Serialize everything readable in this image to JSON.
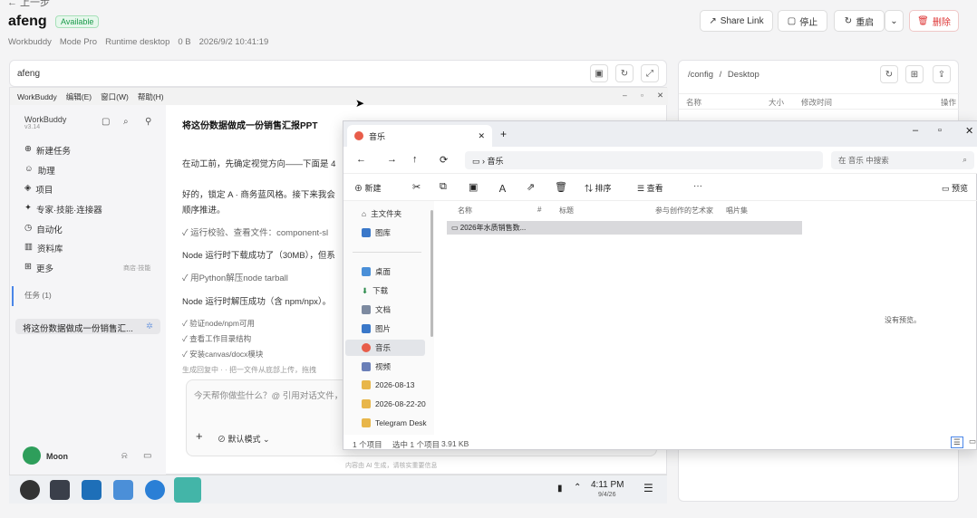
{
  "header": {
    "back": "← 上一步",
    "name": "afeng",
    "status": "Available",
    "meta": [
      "Workbuddy",
      "Mode Pro",
      "Runtime desktop",
      "0 B",
      "2026/9/2 10:41:19"
    ],
    "buttons": {
      "share": "Share Link",
      "stop": "停止",
      "restart": "重启",
      "delete": "删除"
    }
  },
  "remote": {
    "tab": "afeng"
  },
  "files": {
    "path_root": "/config",
    "path_sep": "/",
    "path_leaf": "Desktop",
    "cols": [
      "名称",
      "大小",
      "修改时间",
      "操作"
    ]
  },
  "workbuddy": {
    "menu": [
      "WorkBuddy",
      "编辑(E)",
      "窗口(W)",
      "帮助(H)"
    ],
    "app": "WorkBuddy",
    "version": "v3.14",
    "nav": [
      "新建任务",
      "助理",
      "项目",
      "专家·技能·连接器",
      "自动化",
      "资料库",
      "更多"
    ],
    "more_hint": "商店·技能",
    "tasks_label": "任务 (1)",
    "task_item": "将这份数据做成一份销售汇...",
    "user": "Moon",
    "chat_title": "将这份数据做成一份销售汇报PPT",
    "lines": [
      "在动工前，先确定视觉方向——下面是 4",
      "好的，锁定 A · 商务蓝风格。接下来我会",
      "顺序推进。",
      "运行校验、查看文件：component-sl",
      "Node 运行时下载成功了（30MB），但系",
      "用Python解压node tarball",
      "Node 运行时解压成功（含 npm/npx）。",
      "验证node/npm可用",
      "查看工作目录结构",
      "安装canvas/docx模块",
      "生成回复中 · · 把一文件从底部上传，拖拽"
    ],
    "input_placeholder": "今天帮你做些什么？@ 引用对话文件，",
    "mode": "默认模式",
    "footer": "内容由 AI 生成，请核实重要信息"
  },
  "taskbar": {
    "time": "4:11 PM",
    "date": "9/4/26"
  },
  "explorer": {
    "tab": "音乐",
    "path": "音乐",
    "search": "在 音乐 中搜索",
    "toolbar": [
      "新建",
      "排序",
      "查看",
      "···"
    ],
    "preview": "预览",
    "nav": [
      "主文件夹",
      "图库",
      "桌面",
      "下载",
      "文档",
      "图片",
      "音乐",
      "视频",
      "2026-08-13",
      "2026-08-22-20",
      "Telegram Desk"
    ],
    "cols": [
      "名称",
      "#",
      "标题",
      "参与创作的艺术家",
      "唱片集"
    ],
    "file": "2026年水质销售数...",
    "empty": "没有预览。",
    "status": [
      "1 个项目",
      "选中 1 个项目",
      "3.91 KB"
    ]
  }
}
